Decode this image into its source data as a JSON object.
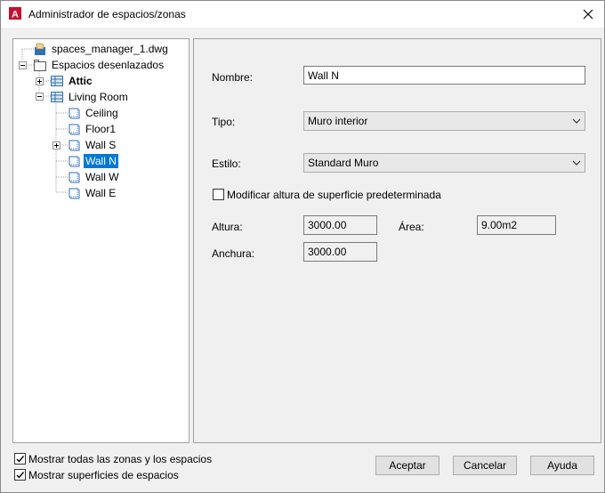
{
  "window": {
    "title": "Administrador de espacios/zonas",
    "app_icon": "autocad-logo-icon",
    "close_icon": "close-icon"
  },
  "tree": {
    "root": "spaces_manager_1.dwg",
    "group": "Espacios desenlazados",
    "attic": "Attic",
    "living_room": "Living Room",
    "ceiling": "Ceiling",
    "floor1": "Floor1",
    "wall_s": "Wall S",
    "wall_n": "Wall N",
    "wall_w": "Wall W",
    "wall_e": "Wall E"
  },
  "form": {
    "nombre_label": "Nombre:",
    "nombre_value": "Wall N",
    "tipo_label": "Tipo:",
    "tipo_value": "Muro interior",
    "estilo_label": "Estilo:",
    "estilo_value": "Standard Muro",
    "modificar_label": "Modificar altura de superficie predeterminada",
    "altura_label": "Altura:",
    "altura_value": "3000.00",
    "area_label": "Área:",
    "area_value": "9.00m2",
    "anchura_label": "Anchura:",
    "anchura_value": "3000.00"
  },
  "footer": {
    "show_all_label": "Mostrar todas las zonas y los espacios",
    "show_surfaces_label": "Mostrar superficies de espacios",
    "accept": "Aceptar",
    "cancel": "Cancelar",
    "help": "Ayuda"
  }
}
